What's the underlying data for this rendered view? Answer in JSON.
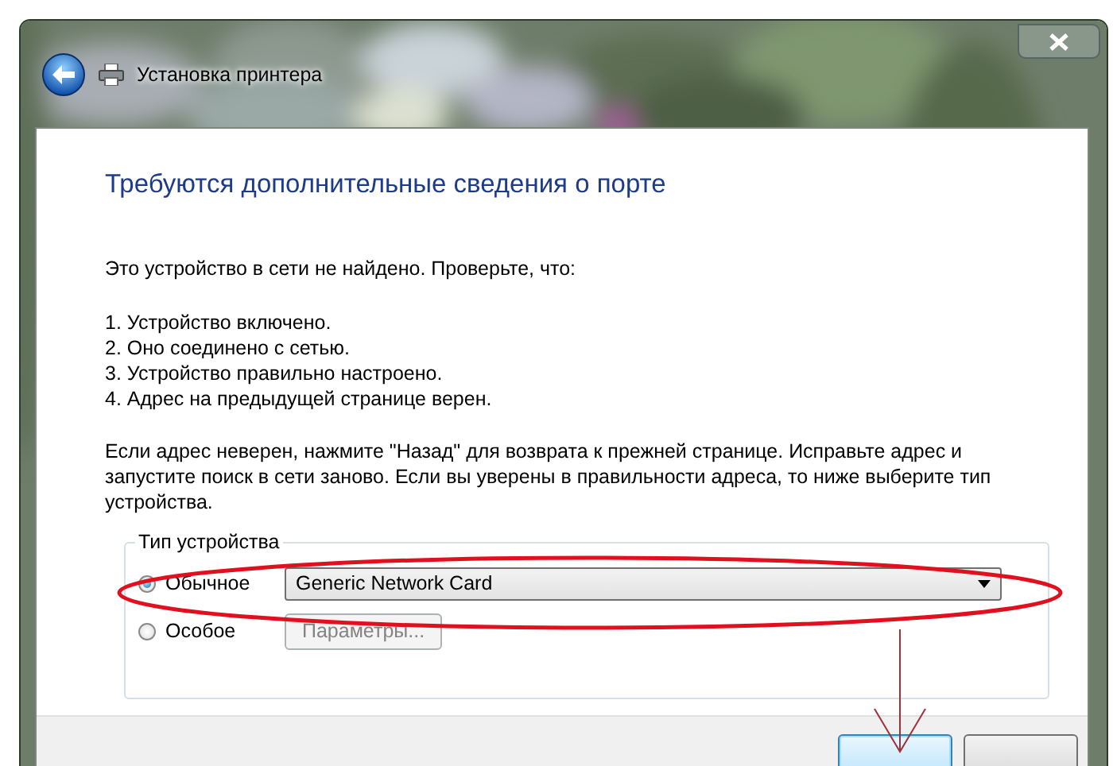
{
  "window": {
    "title": "Установка принтера"
  },
  "heading": "Требуются дополнительные сведения о порте",
  "intro": "Это устройство в сети не найдено. Проверьте, что:",
  "checklist": [
    "1.  Устройство включено.",
    "2.  Оно соединено с сетью.",
    "3.  Устройство правильно настроено.",
    "4.  Адрес на предыдущей странице верен."
  ],
  "advice": "Если адрес неверен, нажмите \"Назад\" для возврата к прежней странице.  Исправьте адрес и запустите поиск в сети заново.  Если вы уверены в правильности адреса, то ниже выберите тип устройства.",
  "device_type": {
    "legend": "Тип устройства",
    "options": [
      {
        "label": "Обычное",
        "selected": true,
        "kind": "dropdown",
        "value": "Generic Network Card"
      },
      {
        "label": "Особое",
        "selected": false,
        "kind": "button",
        "button": "Параметры...",
        "disabled": true
      }
    ]
  },
  "footer_buttons": [
    {
      "default": true
    },
    {
      "default": false
    }
  ]
}
